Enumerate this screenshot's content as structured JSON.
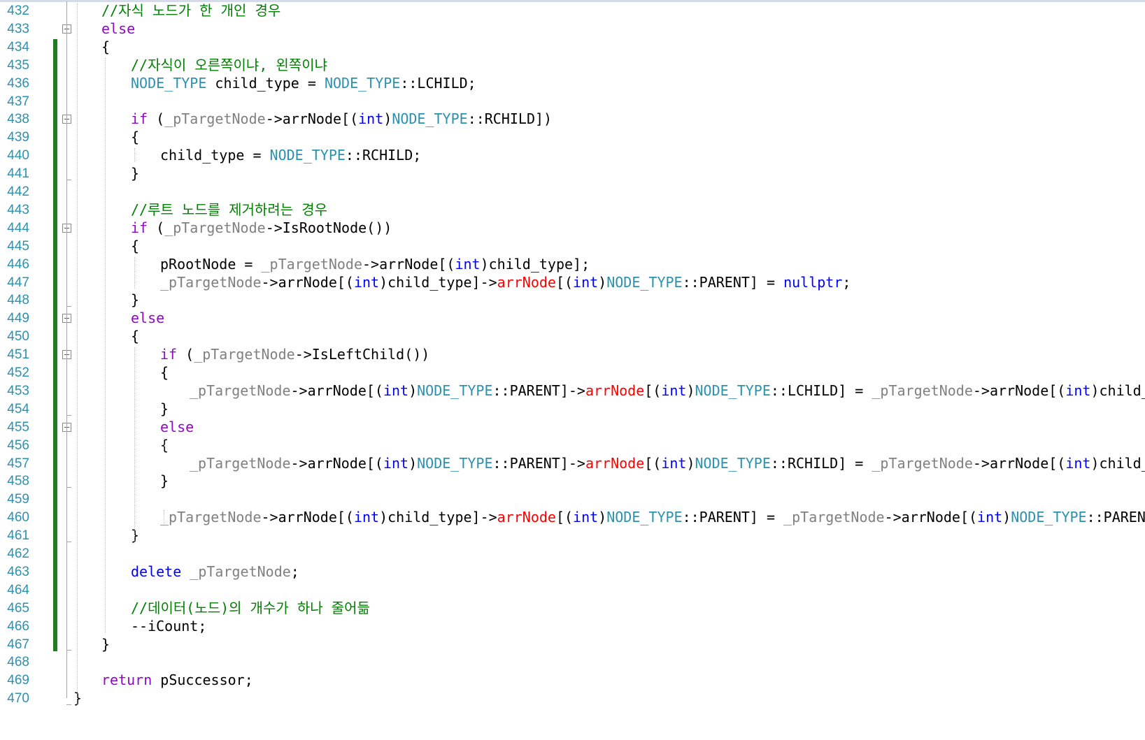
{
  "editor": {
    "colors": {
      "comment": "#008000",
      "keyword": "#8f08c4",
      "blue_keyword": "#0000ff",
      "type": "#2b91af",
      "member": "#808080",
      "red": "#ff0000",
      "plain": "#000000",
      "line_number": "#2b91af",
      "change_bar": "#1e7e1e"
    },
    "lines": [
      {
        "no": "432",
        "indent": 1,
        "tokens": [
          [
            "comment",
            "//자식 노드가 한 개인 경우"
          ]
        ]
      },
      {
        "no": "433",
        "indent": 1,
        "fold": true,
        "tokens": [
          [
            "keyword",
            "else"
          ]
        ]
      },
      {
        "no": "434",
        "indent": 1,
        "tokens": [
          [
            "plain",
            "{"
          ]
        ]
      },
      {
        "no": "435",
        "indent": 2,
        "tokens": [
          [
            "comment",
            "//자식이 오른쪽이냐, 왼쪽이냐"
          ]
        ]
      },
      {
        "no": "436",
        "indent": 2,
        "tokens": [
          [
            "type",
            "NODE_TYPE"
          ],
          [
            "plain",
            " child_type = "
          ],
          [
            "type",
            "NODE_TYPE"
          ],
          [
            "plain",
            "::LCHILD;"
          ]
        ]
      },
      {
        "no": "437",
        "indent": 2,
        "tokens": []
      },
      {
        "no": "438",
        "indent": 2,
        "fold": true,
        "tokens": [
          [
            "keyword",
            "if"
          ],
          [
            "plain",
            " ("
          ],
          [
            "member",
            "_pTargetNode"
          ],
          [
            "plain",
            "->arrNode[("
          ],
          [
            "blue",
            "int"
          ],
          [
            "plain",
            ")"
          ],
          [
            "type",
            "NODE_TYPE"
          ],
          [
            "plain",
            "::RCHILD])"
          ]
        ]
      },
      {
        "no": "439",
        "indent": 2,
        "tokens": [
          [
            "plain",
            "{"
          ]
        ]
      },
      {
        "no": "440",
        "indent": 3,
        "tokens": [
          [
            "plain",
            "child_type = "
          ],
          [
            "type",
            "NODE_TYPE"
          ],
          [
            "plain",
            "::RCHILD;"
          ]
        ]
      },
      {
        "no": "441",
        "indent": 2,
        "tokens": [
          [
            "plain",
            "}"
          ]
        ]
      },
      {
        "no": "442",
        "indent": 2,
        "tokens": []
      },
      {
        "no": "443",
        "indent": 2,
        "tokens": [
          [
            "comment",
            "//루트 노드를 제거하려는 경우"
          ]
        ]
      },
      {
        "no": "444",
        "indent": 2,
        "fold": true,
        "tokens": [
          [
            "keyword",
            "if"
          ],
          [
            "plain",
            " ("
          ],
          [
            "member",
            "_pTargetNode"
          ],
          [
            "plain",
            "->IsRootNode())"
          ]
        ]
      },
      {
        "no": "445",
        "indent": 2,
        "tokens": [
          [
            "plain",
            "{"
          ]
        ]
      },
      {
        "no": "446",
        "indent": 3,
        "tokens": [
          [
            "plain",
            "pRootNode = "
          ],
          [
            "member",
            "_pTargetNode"
          ],
          [
            "plain",
            "->arrNode[("
          ],
          [
            "blue",
            "int"
          ],
          [
            "plain",
            ")child_type];"
          ]
        ]
      },
      {
        "no": "447",
        "indent": 3,
        "tokens": [
          [
            "member",
            "_pTargetNode"
          ],
          [
            "plain",
            "->arrNode[("
          ],
          [
            "blue",
            "int"
          ],
          [
            "plain",
            ")child_type]->"
          ],
          [
            "red",
            "arrNode"
          ],
          [
            "plain",
            "[("
          ],
          [
            "blue",
            "int"
          ],
          [
            "plain",
            ")"
          ],
          [
            "type",
            "NODE_TYPE"
          ],
          [
            "plain",
            "::PARENT] = "
          ],
          [
            "blue",
            "nullptr"
          ],
          [
            "plain",
            ";"
          ]
        ]
      },
      {
        "no": "448",
        "indent": 2,
        "tokens": [
          [
            "plain",
            "}"
          ]
        ]
      },
      {
        "no": "449",
        "indent": 2,
        "fold": true,
        "tokens": [
          [
            "keyword",
            "else"
          ]
        ]
      },
      {
        "no": "450",
        "indent": 2,
        "tokens": [
          [
            "plain",
            "{"
          ]
        ]
      },
      {
        "no": "451",
        "indent": 3,
        "fold": true,
        "tokens": [
          [
            "keyword",
            "if"
          ],
          [
            "plain",
            " ("
          ],
          [
            "member",
            "_pTargetNode"
          ],
          [
            "plain",
            "->IsLeftChild())"
          ]
        ]
      },
      {
        "no": "452",
        "indent": 3,
        "tokens": [
          [
            "plain",
            "{"
          ]
        ]
      },
      {
        "no": "453",
        "indent": 4,
        "tokens": [
          [
            "member",
            "_pTargetNode"
          ],
          [
            "plain",
            "->arrNode[("
          ],
          [
            "blue",
            "int"
          ],
          [
            "plain",
            ")"
          ],
          [
            "type",
            "NODE_TYPE"
          ],
          [
            "plain",
            "::PARENT]->"
          ],
          [
            "red",
            "arrNode"
          ],
          [
            "plain",
            "[("
          ],
          [
            "blue",
            "int"
          ],
          [
            "plain",
            ")"
          ],
          [
            "type",
            "NODE_TYPE"
          ],
          [
            "plain",
            "::LCHILD] = "
          ],
          [
            "member",
            "_pTargetNode"
          ],
          [
            "plain",
            "->arrNode[("
          ],
          [
            "blue",
            "int"
          ],
          [
            "plain",
            ")child_type];"
          ]
        ]
      },
      {
        "no": "454",
        "indent": 3,
        "tokens": [
          [
            "plain",
            "}"
          ]
        ]
      },
      {
        "no": "455",
        "indent": 3,
        "fold": true,
        "tokens": [
          [
            "keyword",
            "else"
          ]
        ]
      },
      {
        "no": "456",
        "indent": 3,
        "tokens": [
          [
            "plain",
            "{"
          ]
        ]
      },
      {
        "no": "457",
        "indent": 4,
        "tokens": [
          [
            "member",
            "_pTargetNode"
          ],
          [
            "plain",
            "->arrNode[("
          ],
          [
            "blue",
            "int"
          ],
          [
            "plain",
            ")"
          ],
          [
            "type",
            "NODE_TYPE"
          ],
          [
            "plain",
            "::PARENT]->"
          ],
          [
            "red",
            "arrNode"
          ],
          [
            "plain",
            "[("
          ],
          [
            "blue",
            "int"
          ],
          [
            "plain",
            ")"
          ],
          [
            "type",
            "NODE_TYPE"
          ],
          [
            "plain",
            "::RCHILD] = "
          ],
          [
            "member",
            "_pTargetNode"
          ],
          [
            "plain",
            "->arrNode[("
          ],
          [
            "blue",
            "int"
          ],
          [
            "plain",
            ")child_type];"
          ]
        ]
      },
      {
        "no": "458",
        "indent": 3,
        "tokens": [
          [
            "plain",
            "}"
          ]
        ]
      },
      {
        "no": "459",
        "indent": 3,
        "tokens": []
      },
      {
        "no": "460",
        "indent": 3,
        "tokens": [
          [
            "member",
            "_pTargetNode"
          ],
          [
            "plain",
            "->arrNode[("
          ],
          [
            "blue",
            "int"
          ],
          [
            "plain",
            ")child_type]->"
          ],
          [
            "red",
            "arrNode"
          ],
          [
            "plain",
            "[("
          ],
          [
            "blue",
            "int"
          ],
          [
            "plain",
            ")"
          ],
          [
            "type",
            "NODE_TYPE"
          ],
          [
            "plain",
            "::PARENT] = "
          ],
          [
            "member",
            "_pTargetNode"
          ],
          [
            "plain",
            "->arrNode[("
          ],
          [
            "blue",
            "int"
          ],
          [
            "plain",
            ")"
          ],
          [
            "type",
            "NODE_TYPE"
          ],
          [
            "plain",
            "::PARENT];"
          ]
        ]
      },
      {
        "no": "461",
        "indent": 2,
        "tokens": [
          [
            "plain",
            "}"
          ]
        ]
      },
      {
        "no": "462",
        "indent": 2,
        "tokens": []
      },
      {
        "no": "463",
        "indent": 2,
        "tokens": [
          [
            "blue",
            "delete"
          ],
          [
            "plain",
            " "
          ],
          [
            "member",
            "_pTargetNode"
          ],
          [
            "plain",
            ";"
          ]
        ]
      },
      {
        "no": "464",
        "indent": 2,
        "tokens": []
      },
      {
        "no": "465",
        "indent": 2,
        "tokens": [
          [
            "comment",
            "//데이터(노드)의 개수가 하나 줄어듦"
          ]
        ]
      },
      {
        "no": "466",
        "indent": 2,
        "tokens": [
          [
            "plain",
            "--iCount;"
          ]
        ]
      },
      {
        "no": "467",
        "indent": 1,
        "tokens": [
          [
            "plain",
            "}"
          ]
        ]
      },
      {
        "no": "468",
        "indent": 1,
        "tokens": []
      },
      {
        "no": "469",
        "indent": 1,
        "tokens": [
          [
            "keyword",
            "return"
          ],
          [
            "plain",
            " pSuccessor;"
          ]
        ]
      },
      {
        "no": "470",
        "indent": 0,
        "tokens": [
          [
            "plain",
            "}"
          ]
        ]
      }
    ]
  }
}
